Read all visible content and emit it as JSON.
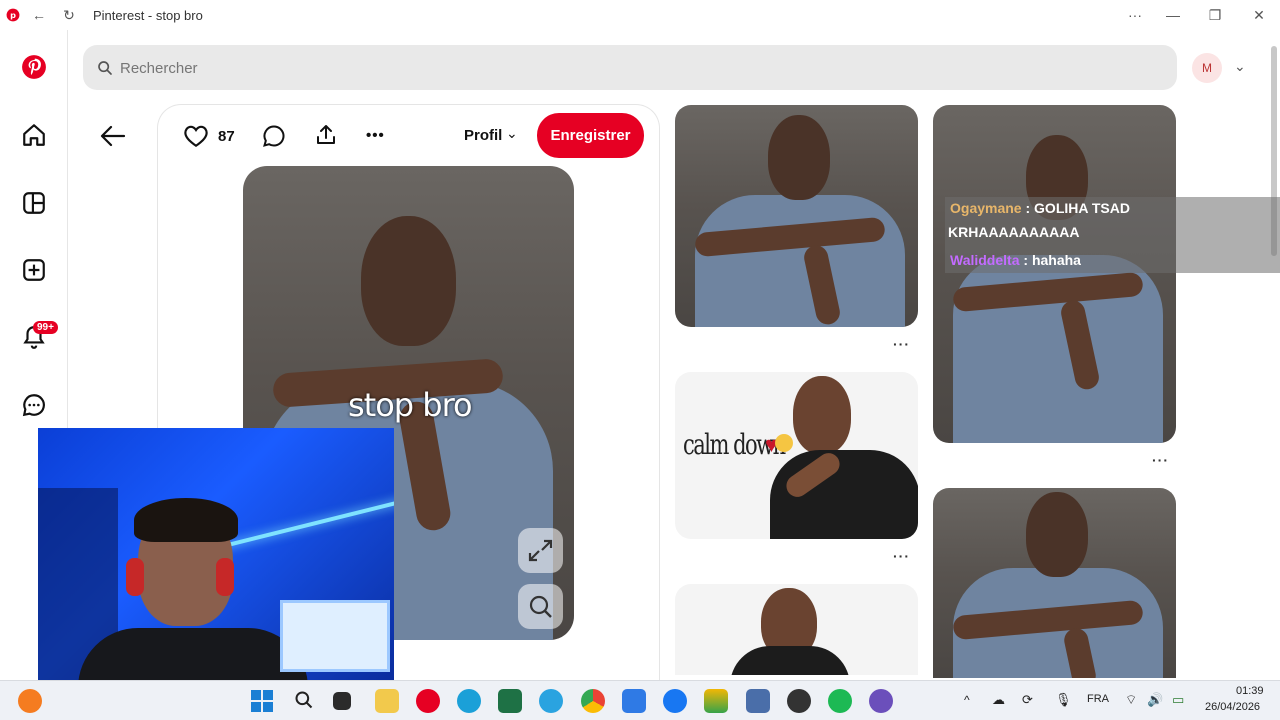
{
  "window": {
    "title": "Pinterest - stop bro",
    "controls": {
      "more": "···",
      "minimize": "—",
      "restore": "❐",
      "close": "✕"
    }
  },
  "search": {
    "placeholder": "Rechercher"
  },
  "account": {
    "avatar_letter": "M"
  },
  "sidebar": {
    "notifications_badge": "99+"
  },
  "pin": {
    "like_count": "87",
    "profile_label": "Profil",
    "save_label": "Enregistrer",
    "more_label": "•••",
    "caption": "stop bro"
  },
  "feed": {
    "calm_down_text": "calm down",
    "more_label": "···"
  },
  "chat": {
    "messages": [
      {
        "user": "Ogaymane",
        "sep": " : ",
        "text": "GOLIHA TSAD",
        "cont": "KRHAAAAAAAAAA",
        "user_color": "#e8b66a"
      },
      {
        "user": "Waliddelta",
        "sep": " : ",
        "text": "hahaha",
        "user_color": "#c36bff"
      }
    ]
  },
  "taskbar": {
    "language": "FRA",
    "time": "01:39",
    "date": "26/04/2026"
  },
  "colors": {
    "accent": "#e60023",
    "brand": "#e60023"
  }
}
